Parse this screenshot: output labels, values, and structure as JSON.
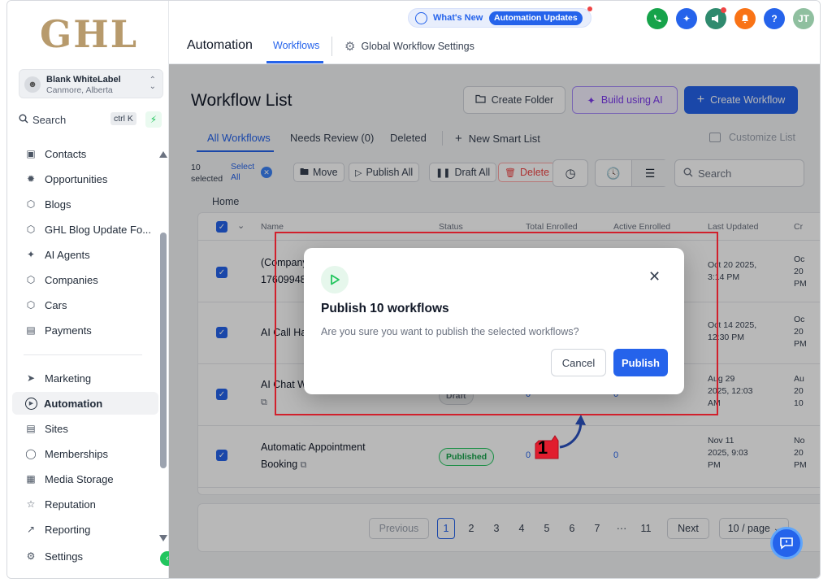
{
  "app": {
    "logo": "GHL",
    "account_name": "Blank WhiteLabel",
    "account_location": "Canmore, Alberta",
    "search_label": "Search",
    "search_shortcut": "ctrl K"
  },
  "sidebar": {
    "items": [
      {
        "label": "Contacts",
        "icon": "contacts-icon"
      },
      {
        "label": "Opportunities",
        "icon": "opportunities-icon"
      },
      {
        "label": "Blogs",
        "icon": "cube-icon"
      },
      {
        "label": "GHL Blog Update Fo...",
        "icon": "cube-icon"
      },
      {
        "label": "AI Agents",
        "icon": "sparkle-icon"
      },
      {
        "label": "Companies",
        "icon": "cube-icon"
      },
      {
        "label": "Cars",
        "icon": "cube-icon"
      },
      {
        "label": "Payments",
        "icon": "payments-icon"
      },
      {
        "label": "Marketing",
        "icon": "send-icon"
      },
      {
        "label": "Automation",
        "icon": "play-circle-icon",
        "active": true
      },
      {
        "label": "Sites",
        "icon": "sites-icon"
      },
      {
        "label": "Memberships",
        "icon": "award-icon"
      },
      {
        "label": "Media Storage",
        "icon": "image-icon"
      },
      {
        "label": "Reputation",
        "icon": "star-icon"
      },
      {
        "label": "Reporting",
        "icon": "trend-icon"
      },
      {
        "label": "Settings",
        "icon": "gear-icon"
      }
    ]
  },
  "topbar": {
    "whats_new": "What's New",
    "automation_updates": "Automation Updates",
    "avatar_initials": "JT",
    "help_glyph": "?",
    "title": "Automation",
    "tab_workflows": "Workflows",
    "tab_global_settings": "Global Workflow Settings",
    "colors": {
      "phone": "#16a34a",
      "magic": "#2563eb",
      "megaphone": "#2f8a6e",
      "bell": "#f97316",
      "help": "#2563eb",
      "avatar": "#8fbf9f"
    }
  },
  "main": {
    "title": "Workflow List",
    "create_folder": "Create Folder",
    "build_ai": "Build using AI",
    "create_workflow": "Create Workflow",
    "tabs": {
      "all": "All Workflows",
      "needs_review": "Needs Review (0)",
      "deleted": "Deleted",
      "new_smart_list": "New Smart List",
      "customize_list": "Customize List"
    },
    "selection": {
      "count": "10",
      "word": "selected",
      "select": "Select",
      "all": "All"
    },
    "bulk": {
      "move": "Move",
      "publish_all": "Publish All",
      "draft_all": "Draft All",
      "delete": "Delete"
    },
    "search_placeholder": "Search",
    "breadcrumb": "Home",
    "columns": [
      "Name",
      "Status",
      "Total Enrolled",
      "Active Enrolled",
      "Last Updated",
      "Cr"
    ],
    "rows": [
      {
        "name1": "(Company)",
        "name2": "17609948",
        "status": "",
        "total": "",
        "active": "",
        "updated1": "Oct 20 2025,",
        "updated2": "3:14 PM",
        "cr1": "Oc",
        "cr2": "20",
        "cr3": "PM"
      },
      {
        "name1": "AI Call Han",
        "name2": "",
        "status": "",
        "total": "",
        "active": "",
        "updated1": "Oct 14 2025,",
        "updated2": "12:30 PM",
        "cr1": "Oc",
        "cr2": "20",
        "cr3": "PM"
      },
      {
        "name1": "AI Chat Wid",
        "name2": "",
        "status": "Draft",
        "total": "0",
        "active": "0",
        "updated1": "Aug 29",
        "updated2": "2025, 12:03",
        "updated3": "AM",
        "cr1": "Au",
        "cr2": "20",
        "cr3": "10"
      },
      {
        "name1": "Automatic Appointment",
        "name2": "Booking",
        "status": "Published",
        "total": "0",
        "active": "0",
        "updated1": "Nov 11",
        "updated2": "2025, 9:03",
        "updated3": "PM",
        "cr1": "No",
        "cr2": "20",
        "cr3": "PM"
      }
    ],
    "pagination": {
      "previous": "Previous",
      "pages": [
        "1",
        "2",
        "3",
        "4",
        "5",
        "6",
        "7",
        "···",
        "11"
      ],
      "current": "1",
      "next": "Next",
      "per_page": "10 / page"
    }
  },
  "modal": {
    "title": "Publish 10 workflows",
    "message": "Are you sure you want to publish the selected workflows?",
    "cancel": "Cancel",
    "publish": "Publish"
  },
  "annotation": {
    "step": "1",
    "color": "#d1202c"
  }
}
